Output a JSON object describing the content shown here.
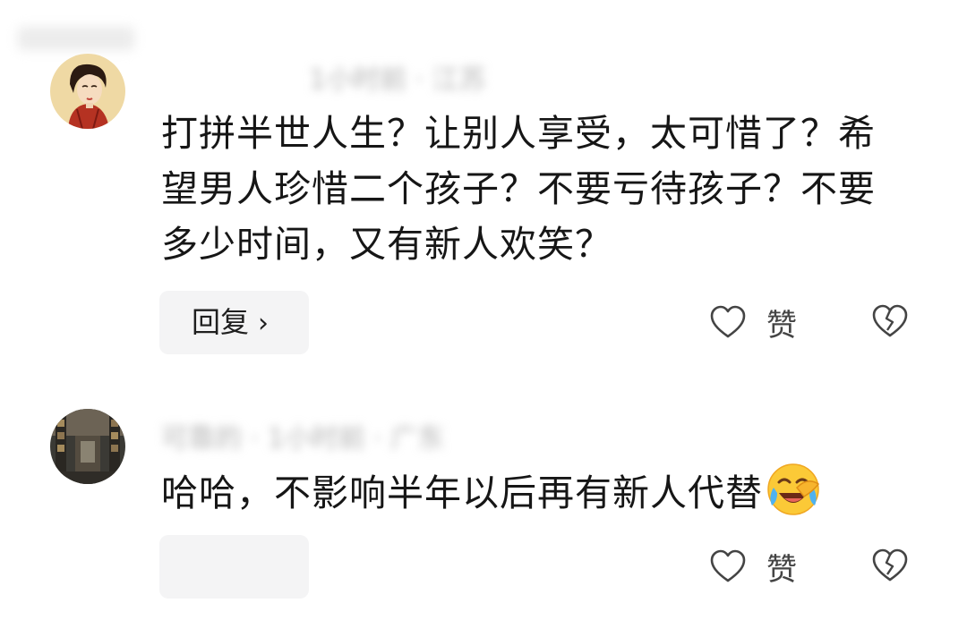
{
  "comments": [
    {
      "meta": "1小时前 · 江苏",
      "text": "打拼半世人生？让别人享受，太可惜了？希望男人珍惜二个孩子？不要亏待孩子？不要多少时间，又有新人欢笑？",
      "reply_label": "回复",
      "like_label": "赞",
      "icons": [
        "avatar",
        "chevron-right-icon",
        "heart-icon",
        "broken-heart-icon"
      ]
    },
    {
      "meta": "可靠的 · 1小时前 · 广东",
      "text": "哈哈，不影响半年以后再有新人代替",
      "emoji": "crying-laughing-emoji-icon",
      "like_label": "赞",
      "icons": [
        "avatar",
        "heart-icon",
        "broken-heart-icon"
      ]
    }
  ]
}
